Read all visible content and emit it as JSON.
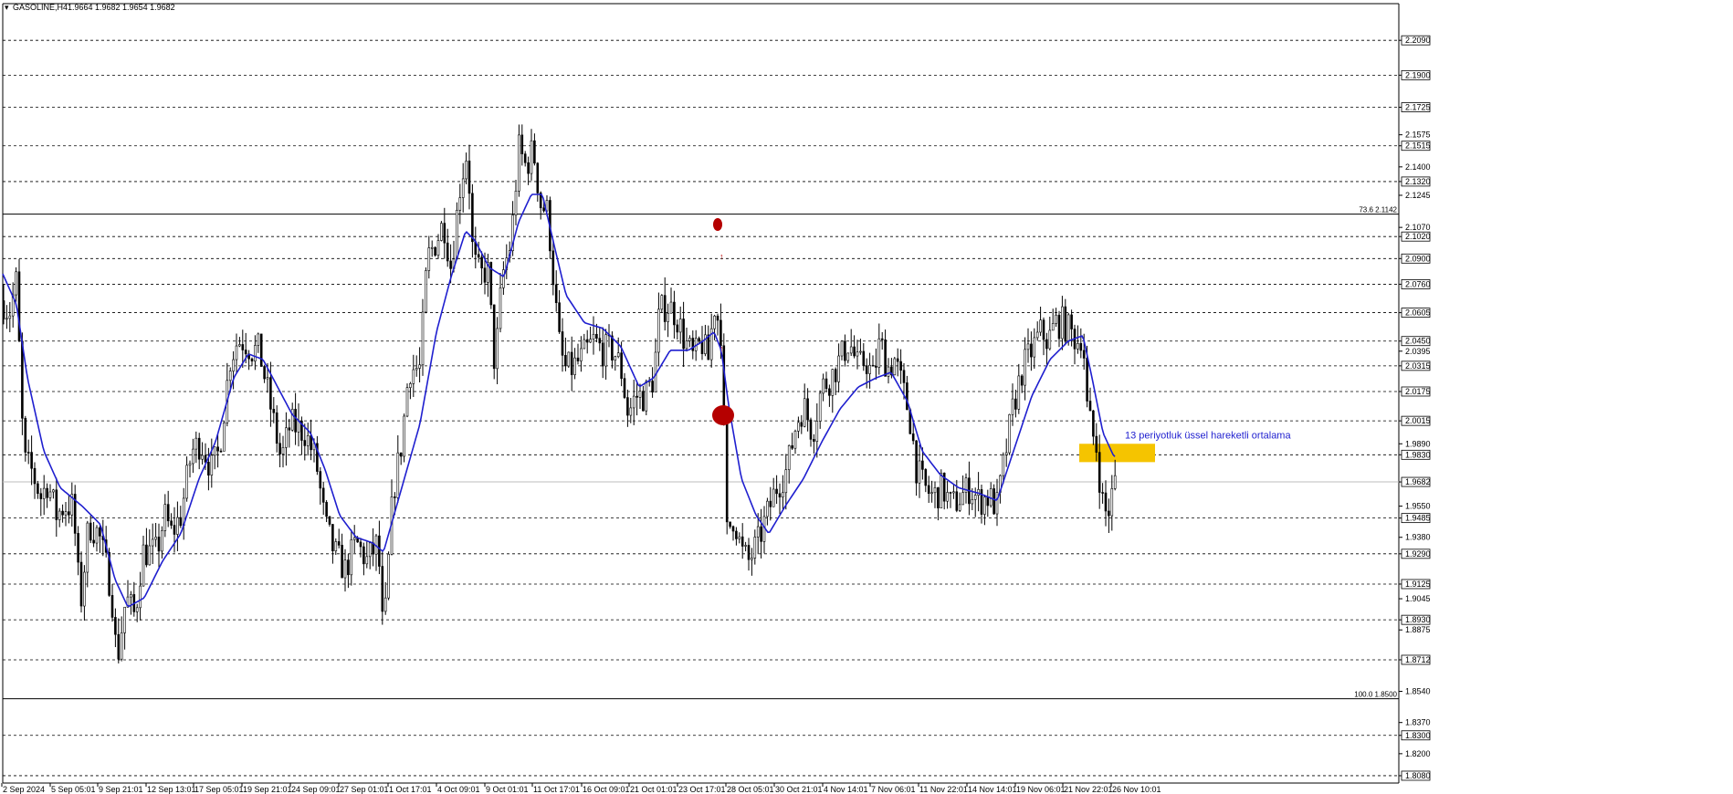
{
  "header": {
    "symbol": "GASOLINE,H4",
    "ohlc": "1.9664 1.9682 1.9654 1.9682"
  },
  "colors": {
    "background": "#ffffff",
    "candle": "#000000",
    "ema": "#1f1fcf",
    "level_line": "#000000",
    "zone": "#f5c400",
    "marker": "#b50000",
    "annotation": "#1f1fcf"
  },
  "chart_data": {
    "type": "candlestick",
    "symbol": "GASOLINE",
    "timeframe": "H4",
    "ylim": [
      1.804,
      2.229
    ],
    "grid": false,
    "y_ticks": [
      "2.2090",
      "2.1900",
      "2.1725",
      "2.1575",
      "2.1515",
      "2.1400",
      "2.1320",
      "2.1245",
      "2.1070",
      "2.1020",
      "2.0900",
      "2.0760",
      "2.0605",
      "2.0450",
      "2.0395",
      "2.0315",
      "2.0175",
      "2.0015",
      "1.9890",
      "1.9830",
      "1.9682",
      "1.9550",
      "1.9485",
      "1.9380",
      "1.9290",
      "1.9125",
      "1.9045",
      "1.8930",
      "1.8875",
      "1.8712",
      "1.8540",
      "1.8370",
      "1.8300",
      "1.8200",
      "1.8080"
    ],
    "highlighted_ticks": [
      "2.2090",
      "2.1900",
      "2.1725",
      "2.1515",
      "2.1320",
      "2.1020",
      "2.0900",
      "2.0760",
      "2.0605",
      "2.0450",
      "2.0315",
      "2.0175",
      "2.0015",
      "1.9830",
      "1.9682",
      "1.9485",
      "1.9290",
      "1.9125",
      "1.8930",
      "1.8712",
      "1.8300",
      "1.8080"
    ],
    "dashed_levels": [
      2.209,
      2.19,
      2.1725,
      2.1515,
      2.132,
      2.102,
      2.09,
      2.076,
      2.0605,
      2.045,
      2.0315,
      2.0175,
      2.0015,
      1.983,
      1.9485,
      1.929,
      1.9125,
      1.893,
      1.8712,
      1.83,
      1.808
    ],
    "current_price": 1.9682,
    "x_labels": [
      "2 Sep 2024",
      "5 Sep 05:01",
      "9 Sep 21:01",
      "12 Sep 13:01",
      "17 Sep 05:01",
      "19 Sep 21:01",
      "24 Sep 09:01",
      "27 Sep 01:01",
      "1 Oct 17:01",
      "4 Oct 09:01",
      "9 Oct 01:01",
      "11 Oct 17:01",
      "16 Oct 09:01",
      "21 Oct 01:01",
      "23 Oct 17:01",
      "28 Oct 05:01",
      "30 Oct 21:01",
      "4 Nov 14:01",
      "7 Nov 06:01",
      "11 Nov 22:01",
      "14 Nov 14:01",
      "19 Nov 06:01",
      "21 Nov 22:01",
      "26 Nov 10:01"
    ],
    "fibonacci": [
      {
        "label": "73.6 2.1142",
        "price": 2.1142
      },
      {
        "label": "100.0 1.8500",
        "price": 1.85
      }
    ],
    "ema_label": "13 periyotluk üssel hareketli ortalama",
    "close_waypoints": [
      [
        0,
        2.07
      ],
      [
        10,
        2.06
      ],
      [
        18,
        2.078
      ],
      [
        26,
        1.98
      ],
      [
        34,
        1.975
      ],
      [
        45,
        1.96
      ],
      [
        52,
        1.968
      ],
      [
        62,
        1.95
      ],
      [
        70,
        1.955
      ],
      [
        80,
        1.955
      ],
      [
        88,
        1.9
      ],
      [
        97,
        1.945
      ],
      [
        108,
        1.94
      ],
      [
        122,
        1.91
      ],
      [
        128,
        1.87
      ],
      [
        138,
        1.905
      ],
      [
        148,
        1.895
      ],
      [
        156,
        1.93
      ],
      [
        172,
        1.93
      ],
      [
        180,
        1.95
      ],
      [
        188,
        1.94
      ],
      [
        198,
        1.95
      ],
      [
        210,
        1.985
      ],
      [
        220,
        1.99
      ],
      [
        232,
        1.975
      ],
      [
        240,
        1.985
      ],
      [
        252,
        2.035
      ],
      [
        260,
        2.045
      ],
      [
        268,
        2.045
      ],
      [
        276,
        2.04
      ],
      [
        284,
        2.04
      ],
      [
        296,
        2.01
      ],
      [
        308,
        1.98
      ],
      [
        318,
        2.0
      ],
      [
        334,
        1.995
      ],
      [
        346,
        1.98
      ],
      [
        356,
        1.945
      ],
      [
        366,
        1.93
      ],
      [
        378,
        1.92
      ],
      [
        390,
        1.935
      ],
      [
        402,
        1.925
      ],
      [
        414,
        1.935
      ],
      [
        420,
        1.88
      ],
      [
        430,
        1.96
      ],
      [
        440,
        1.99
      ],
      [
        448,
        2.03
      ],
      [
        460,
        2.03
      ],
      [
        468,
        2.09
      ],
      [
        478,
        2.1
      ],
      [
        486,
        2.11
      ],
      [
        494,
        2.085
      ],
      [
        504,
        2.13
      ],
      [
        512,
        2.15
      ],
      [
        518,
        2.09
      ],
      [
        526,
        2.08
      ],
      [
        534,
        2.085
      ],
      [
        542,
        2.03
      ],
      [
        550,
        2.08
      ],
      [
        560,
        2.1
      ],
      [
        568,
        2.15
      ],
      [
        576,
        2.14
      ],
      [
        584,
        2.15
      ],
      [
        592,
        2.12
      ],
      [
        600,
        2.115
      ],
      [
        606,
        2.08
      ],
      [
        612,
        2.045
      ],
      [
        618,
        2.03
      ],
      [
        626,
        2.03
      ],
      [
        636,
        2.035
      ],
      [
        650,
        2.045
      ],
      [
        660,
        2.04
      ],
      [
        672,
        2.04
      ],
      [
        680,
        2.03
      ],
      [
        688,
        2.005
      ],
      [
        696,
        2.015
      ],
      [
        706,
        2.015
      ],
      [
        716,
        2.025
      ],
      [
        722,
        2.06
      ],
      [
        730,
        2.065
      ],
      [
        740,
        2.06
      ],
      [
        750,
        2.045
      ],
      [
        760,
        2.035
      ],
      [
        768,
        2.045
      ],
      [
        776,
        2.035
      ],
      [
        782,
        2.065
      ],
      [
        790,
        2.05
      ],
      [
        796,
        1.94
      ],
      [
        804,
        1.95
      ],
      [
        812,
        1.93
      ],
      [
        820,
        1.925
      ],
      [
        830,
        1.935
      ],
      [
        840,
        1.95
      ],
      [
        850,
        1.965
      ],
      [
        862,
        1.975
      ],
      [
        872,
        2.0
      ],
      [
        880,
        2.01
      ],
      [
        890,
        1.995
      ],
      [
        900,
        2.02
      ],
      [
        910,
        2.025
      ],
      [
        920,
        2.035
      ],
      [
        930,
        2.045
      ],
      [
        940,
        2.03
      ],
      [
        948,
        2.035
      ],
      [
        956,
        2.025
      ],
      [
        964,
        2.045
      ],
      [
        972,
        2.03
      ],
      [
        980,
        2.035
      ],
      [
        988,
        2.02
      ],
      [
        996,
        2.005
      ],
      [
        1004,
        1.975
      ],
      [
        1012,
        1.965
      ],
      [
        1022,
        1.96
      ],
      [
        1032,
        1.965
      ],
      [
        1042,
        1.955
      ],
      [
        1052,
        1.96
      ],
      [
        1062,
        1.965
      ],
      [
        1072,
        1.958
      ],
      [
        1082,
        1.96
      ],
      [
        1092,
        1.955
      ],
      [
        1100,
        1.98
      ],
      [
        1110,
        2.01
      ],
      [
        1120,
        2.03
      ],
      [
        1130,
        2.04
      ],
      [
        1140,
        2.05
      ],
      [
        1148,
        2.045
      ],
      [
        1156,
        2.055
      ],
      [
        1164,
        2.055
      ],
      [
        1172,
        2.05
      ],
      [
        1180,
        2.045
      ],
      [
        1186,
        2.05
      ],
      [
        1190,
        2.01
      ],
      [
        1196,
        1.995
      ],
      [
        1202,
        1.985
      ],
      [
        1206,
        1.96
      ],
      [
        1212,
        1.95
      ],
      [
        1216,
        1.955
      ],
      [
        1220,
        1.968
      ]
    ],
    "ema_waypoints": [
      [
        0,
        2.085
      ],
      [
        18,
        2.065
      ],
      [
        30,
        2.025
      ],
      [
        48,
        1.985
      ],
      [
        66,
        1.965
      ],
      [
        90,
        1.955
      ],
      [
        110,
        1.945
      ],
      [
        126,
        1.915
      ],
      [
        140,
        1.9
      ],
      [
        158,
        1.905
      ],
      [
        178,
        1.925
      ],
      [
        198,
        1.94
      ],
      [
        218,
        1.97
      ],
      [
        236,
        1.99
      ],
      [
        256,
        2.025
      ],
      [
        272,
        2.038
      ],
      [
        288,
        2.035
      ],
      [
        304,
        2.02
      ],
      [
        320,
        2.005
      ],
      [
        340,
        1.995
      ],
      [
        356,
        1.975
      ],
      [
        372,
        1.95
      ],
      [
        390,
        1.938
      ],
      [
        408,
        1.935
      ],
      [
        420,
        1.93
      ],
      [
        440,
        1.965
      ],
      [
        460,
        2.0
      ],
      [
        478,
        2.05
      ],
      [
        494,
        2.08
      ],
      [
        510,
        2.105
      ],
      [
        520,
        2.1
      ],
      [
        536,
        2.085
      ],
      [
        552,
        2.08
      ],
      [
        568,
        2.11
      ],
      [
        582,
        2.125
      ],
      [
        594,
        2.125
      ],
      [
        608,
        2.095
      ],
      [
        620,
        2.07
      ],
      [
        640,
        2.055
      ],
      [
        660,
        2.052
      ],
      [
        680,
        2.042
      ],
      [
        700,
        2.02
      ],
      [
        716,
        2.025
      ],
      [
        734,
        2.04
      ],
      [
        754,
        2.04
      ],
      [
        770,
        2.045
      ],
      [
        782,
        2.05
      ],
      [
        790,
        2.04
      ],
      [
        798,
        2.01
      ],
      [
        812,
        1.97
      ],
      [
        828,
        1.95
      ],
      [
        842,
        1.94
      ],
      [
        860,
        1.955
      ],
      [
        880,
        1.97
      ],
      [
        900,
        1.99
      ],
      [
        920,
        2.008
      ],
      [
        940,
        2.02
      ],
      [
        960,
        2.025
      ],
      [
        976,
        2.028
      ],
      [
        994,
        2.012
      ],
      [
        1010,
        1.985
      ],
      [
        1030,
        1.972
      ],
      [
        1050,
        1.965
      ],
      [
        1072,
        1.962
      ],
      [
        1092,
        1.958
      ],
      [
        1110,
        1.985
      ],
      [
        1130,
        2.015
      ],
      [
        1150,
        2.035
      ],
      [
        1170,
        2.045
      ],
      [
        1186,
        2.048
      ],
      [
        1196,
        2.025
      ],
      [
        1208,
        1.995
      ],
      [
        1220,
        1.982
      ]
    ]
  }
}
